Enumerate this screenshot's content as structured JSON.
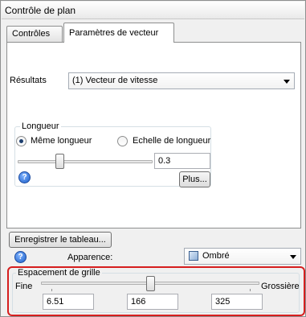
{
  "window": {
    "title": "Contrôle de plan"
  },
  "tabs": [
    {
      "label": "Contrôles",
      "active": false
    },
    {
      "label": "Paramètres de vecteur",
      "active": true
    }
  ],
  "vector_params": {
    "results_label": "Résultats",
    "results_value": "(1) Vecteur de vitesse",
    "length_group": {
      "title": "Longueur",
      "same_length_label": "Même longueur",
      "same_length_checked": true,
      "length_scale_label": "Echelle de longueur",
      "length_scale_checked": false,
      "slider_fraction": 0.33,
      "value": "0.3",
      "more_button": "Plus..."
    }
  },
  "bottom": {
    "save_table_button": "Enregistrer le tableau...",
    "appearance_label": "Apparence:",
    "appearance_value": "Ombré",
    "grid_spacing": {
      "title": "Espacement de grille",
      "fine_label": "Fine",
      "coarse_label": "Grossière",
      "slider_fraction": 0.5,
      "min_value": "6.51",
      "current_value": "166",
      "max_value": "325"
    }
  },
  "colors": {
    "highlight": "#d61e1e",
    "radio_dot": "#1c3e6e",
    "help_blue": "#1d5fc8"
  },
  "icons": [
    "help-icon",
    "shaded-view-icon",
    "chevron-down-icon"
  ]
}
